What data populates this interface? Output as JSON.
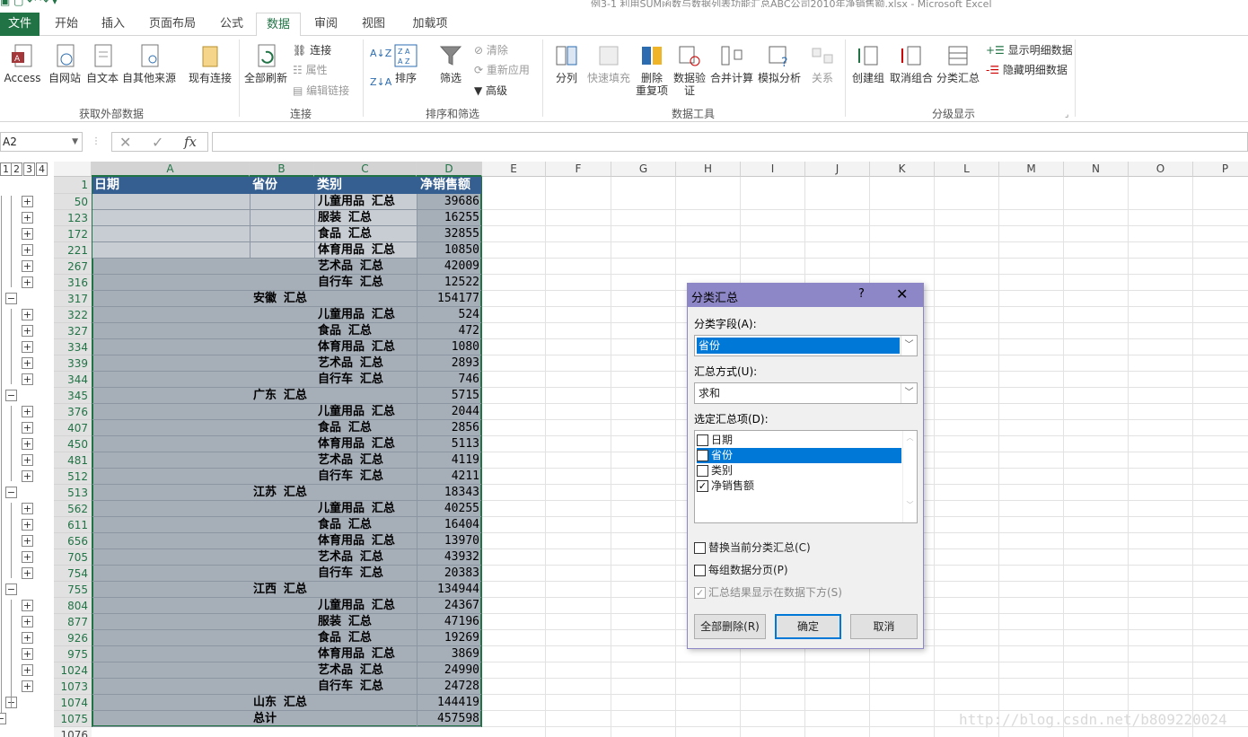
{
  "window": {
    "title": "例3-1 利用SUM函数与数据列表功能汇总ABC公司2010年净销售额.xlsx - Microsoft Excel"
  },
  "tabs": [
    "文件",
    "开始",
    "插入",
    "页面布局",
    "公式",
    "数据",
    "审阅",
    "视图",
    "加载项"
  ],
  "active_tab": "数据",
  "ribbon": {
    "get_external": {
      "access": "Access",
      "web": "自网站",
      "text": "自文本",
      "other": "自其他来源",
      "existing": "现有连接",
      "label": "获取外部数据"
    },
    "connections": {
      "refresh_all": "全部刷新",
      "connections": "连接",
      "properties": "属性",
      "edit_links": "编辑链接",
      "label": "连接"
    },
    "sort_filter": {
      "sort": "排序",
      "filter": "筛选",
      "clear": "清除",
      "reapply": "重新应用",
      "advanced": "高级",
      "label": "排序和筛选"
    },
    "data_tools": {
      "text_to_columns": "分列",
      "flash_fill": "快速填充",
      "remove_dup_1": "删除",
      "remove_dup_2": "重复项",
      "validation_1": "数据验",
      "validation_2": "证",
      "consolidate": "合并计算",
      "what_if": "模拟分析",
      "relationships": "关系",
      "label": "数据工具"
    },
    "outline": {
      "group": "创建组",
      "ungroup": "取消组合",
      "subtotal": "分类汇总",
      "show_detail": "显示明细数据",
      "hide_detail": "隐藏明细数据",
      "label": "分级显示"
    }
  },
  "formula_bar": {
    "name_box": "A2",
    "fx": "fx",
    "formula": ""
  },
  "outline_levels": [
    "1",
    "2",
    "3",
    "4"
  ],
  "columns": [
    "A",
    "B",
    "C",
    "D",
    "E",
    "F",
    "G",
    "H",
    "I",
    "J",
    "K",
    "L",
    "M",
    "N",
    "O",
    "P"
  ],
  "header_row": {
    "row": "1",
    "a": "日期",
    "b": "省份",
    "c": "类别",
    "d": "净销售额"
  },
  "rows": [
    {
      "row": "50",
      "b": "",
      "c": "儿童用品 汇总",
      "d": "39686",
      "type": "sub"
    },
    {
      "row": "123",
      "b": "",
      "c": "服装 汇总",
      "d": "16255",
      "type": "sub"
    },
    {
      "row": "172",
      "b": "",
      "c": "食品 汇总",
      "d": "32855",
      "type": "sub"
    },
    {
      "row": "221",
      "b": "",
      "c": "体育用品 汇总",
      "d": "10850",
      "type": "sub"
    },
    {
      "row": "267",
      "b": "",
      "c": "艺术品 汇总",
      "d": "42009",
      "type": "sub"
    },
    {
      "row": "316",
      "b": "",
      "c": "自行车 汇总",
      "d": "12522",
      "type": "sub"
    },
    {
      "row": "317",
      "b": "安徽 汇总",
      "c": "",
      "d": "154177",
      "type": "prov"
    },
    {
      "row": "322",
      "b": "",
      "c": "儿童用品 汇总",
      "d": "524",
      "type": "sub"
    },
    {
      "row": "327",
      "b": "",
      "c": "食品 汇总",
      "d": "472",
      "type": "sub"
    },
    {
      "row": "334",
      "b": "",
      "c": "体育用品 汇总",
      "d": "1080",
      "type": "sub"
    },
    {
      "row": "339",
      "b": "",
      "c": "艺术品 汇总",
      "d": "2893",
      "type": "sub"
    },
    {
      "row": "344",
      "b": "",
      "c": "自行车 汇总",
      "d": "746",
      "type": "sub"
    },
    {
      "row": "345",
      "b": "广东 汇总",
      "c": "",
      "d": "5715",
      "type": "prov"
    },
    {
      "row": "376",
      "b": "",
      "c": "儿童用品 汇总",
      "d": "2044",
      "type": "sub"
    },
    {
      "row": "407",
      "b": "",
      "c": "食品 汇总",
      "d": "2856",
      "type": "sub"
    },
    {
      "row": "450",
      "b": "",
      "c": "体育用品 汇总",
      "d": "5113",
      "type": "sub"
    },
    {
      "row": "481",
      "b": "",
      "c": "艺术品 汇总",
      "d": "4119",
      "type": "sub"
    },
    {
      "row": "512",
      "b": "",
      "c": "自行车 汇总",
      "d": "4211",
      "type": "sub"
    },
    {
      "row": "513",
      "b": "江苏 汇总",
      "c": "",
      "d": "18343",
      "type": "prov"
    },
    {
      "row": "562",
      "b": "",
      "c": "儿童用品 汇总",
      "d": "40255",
      "type": "sub"
    },
    {
      "row": "611",
      "b": "",
      "c": "食品 汇总",
      "d": "16404",
      "type": "sub"
    },
    {
      "row": "656",
      "b": "",
      "c": "体育用品 汇总",
      "d": "13970",
      "type": "sub"
    },
    {
      "row": "705",
      "b": "",
      "c": "艺术品 汇总",
      "d": "43932",
      "type": "sub"
    },
    {
      "row": "754",
      "b": "",
      "c": "自行车 汇总",
      "d": "20383",
      "type": "sub"
    },
    {
      "row": "755",
      "b": "江西 汇总",
      "c": "",
      "d": "134944",
      "type": "prov"
    },
    {
      "row": "804",
      "b": "",
      "c": "儿童用品 汇总",
      "d": "24367",
      "type": "sub"
    },
    {
      "row": "877",
      "b": "",
      "c": "服装 汇总",
      "d": "47196",
      "type": "sub"
    },
    {
      "row": "926",
      "b": "",
      "c": "食品 汇总",
      "d": "19269",
      "type": "sub"
    },
    {
      "row": "975",
      "b": "",
      "c": "体育用品 汇总",
      "d": "3869",
      "type": "sub"
    },
    {
      "row": "1024",
      "b": "",
      "c": "艺术品 汇总",
      "d": "24990",
      "type": "sub"
    },
    {
      "row": "1073",
      "b": "",
      "c": "自行车 汇总",
      "d": "24728",
      "type": "sub"
    },
    {
      "row": "1074",
      "b": "山东 汇总",
      "c": "",
      "d": "144419",
      "type": "prov"
    },
    {
      "row": "1075",
      "b": "总计",
      "c": "",
      "d": "457598",
      "type": "total"
    },
    {
      "row": "1076",
      "b": "",
      "c": "",
      "d": "",
      "type": "empty"
    }
  ],
  "dialog": {
    "title": "分类汇总",
    "help": "?",
    "close": "✕",
    "group_by_label": "分类字段(A):",
    "group_by_value": "省份",
    "function_label": "汇总方式(U):",
    "function_value": "求和",
    "add_to_label": "选定汇总项(D):",
    "items": [
      {
        "label": "日期",
        "checked": false,
        "selected": false
      },
      {
        "label": "省份",
        "checked": false,
        "selected": true
      },
      {
        "label": "类别",
        "checked": false,
        "selected": false
      },
      {
        "label": "净销售额",
        "checked": true,
        "selected": false
      }
    ],
    "replace_current": "替换当前分类汇总(C)",
    "page_break": "每组数据分页(P)",
    "summary_below": "汇总结果显示在数据下方(S)",
    "remove_all": "全部删除(R)",
    "ok": "确定",
    "cancel": "取消"
  },
  "watermark": "http://blog.csdn.net/b809220024"
}
